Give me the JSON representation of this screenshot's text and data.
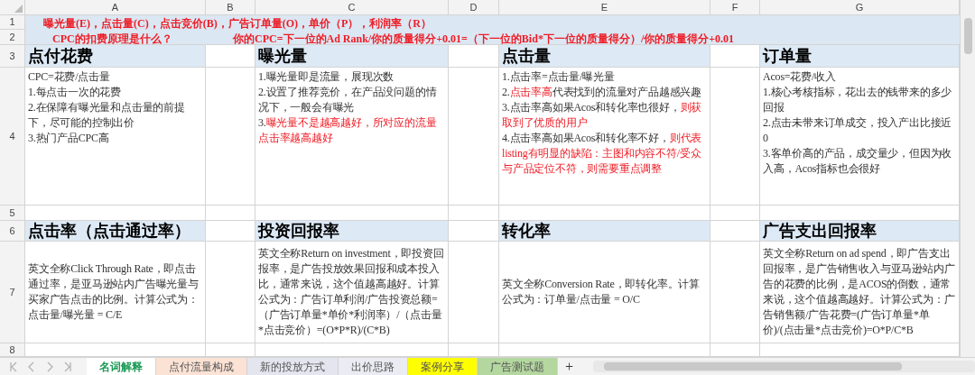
{
  "columns": [
    "A",
    "B",
    "C",
    "D",
    "E",
    "F",
    "G"
  ],
  "row_numbers": [
    "1",
    "2",
    "3",
    "4",
    "5",
    "6",
    "7",
    "8"
  ],
  "banner": {
    "line_1": "曝光量(E)，点击量(C)，点击竞价(B)，广告订单量(O)，单价（P），利润率（R）",
    "question": "CPC的扣费原理是什么？",
    "formula": "你的CPC=下一位的Ad Rank/你的质量得分+0.01=（下一位的Bid*下一位的质量得分）/你的质量得分+0.01"
  },
  "blocks": [
    {
      "sections": [
        {
          "title": "点付花费",
          "paragraphs": [
            [
              {
                "text": "CPC=花费/点击量",
                "emphasized": false
              }
            ],
            [
              {
                "text": "1.每点击一次的花费",
                "emphasized": false
              }
            ],
            [
              {
                "text": "2.在保障有曝光量和点击量的前提下，尽可能的控制出价",
                "emphasized": false
              }
            ],
            [
              {
                "text": "3.热门产品CPC高",
                "emphasized": false
              }
            ]
          ]
        },
        {
          "title": "曝光量",
          "paragraphs": [
            [
              {
                "text": "1.曝光量即是流量，展现次数",
                "emphasized": false
              }
            ],
            [
              {
                "text": "2.设置了推荐竞价，在产品没问题的情况下，一般会有曝光",
                "emphasized": false
              }
            ],
            [
              {
                "text": "3.",
                "emphasized": false
              },
              {
                "text": "曝光量不是越高越好，所对应的流量点击率越高越好",
                "emphasized": true
              }
            ]
          ]
        },
        {
          "title": "点击量",
          "paragraphs": [
            [
              {
                "text": "1.点击率=点击量/曝光量",
                "emphasized": false
              }
            ],
            [
              {
                "text": "2.",
                "emphasized": false
              },
              {
                "text": "点击率高",
                "emphasized": true
              },
              {
                "text": "代表找到的流量对产品越感兴趣",
                "emphasized": false
              }
            ],
            [
              {
                "text": "3.点击率高如果Acos和转化率也很好，",
                "emphasized": false
              },
              {
                "text": "则获取到了优质的用户",
                "emphasized": true
              }
            ],
            [
              {
                "text": "4.点击率高如果Acos和转化率不好，",
                "emphasized": false
              },
              {
                "text": "则代表listing有明显的缺陷：主图和内容不符/受众与产品定位不符，则需要重点调整",
                "emphasized": true
              }
            ]
          ]
        },
        {
          "title": "订单量",
          "paragraphs": [
            [
              {
                "text": "Acos=花费/收入",
                "emphasized": false
              }
            ],
            [
              {
                "text": "1.核心考核指标，花出去的钱带来的多少回报",
                "emphasized": false
              }
            ],
            [
              {
                "text": "2.点击未带来订单成交，投入产出比接近0",
                "emphasized": false
              }
            ],
            [
              {
                "text": "3.客单价高的产品，成交量少，但因为收入高，Acos指标也会很好",
                "emphasized": false
              }
            ]
          ]
        }
      ]
    },
    {
      "sections": [
        {
          "title": "点击率（点击通过率）",
          "paragraphs": [
            [
              {
                "text": "英文全称Click Through Rate，即点击通过率，是亚马逊站内广告曝光量与买家广告点击的比例。计算公式为：点击量/曝光量 = C/E",
                "emphasized": false
              }
            ]
          ]
        },
        {
          "title": "投资回报率",
          "paragraphs": [
            [
              {
                "text": "英文全称Return on investment，即投资回报率，是广告投放效果回报和成本投入比，通常来说，这个值越高越好。计算公式为：广告订单利润/广告投资总额=（广告订单量*单价*利润率）/（点击量*点击竞价）=(O*P*R)/(C*B)",
                "emphasized": false
              }
            ]
          ]
        },
        {
          "title": "转化率",
          "paragraphs": [
            [
              {
                "text": "英文全称Conversion Rate，即转化率。计算公式为：订单量/点击量 = O/C",
                "emphasized": false
              }
            ]
          ]
        },
        {
          "title": "广告支出回报率",
          "paragraphs": [
            [
              {
                "text": "英文全称Return on ad spend，即广告支出回报率，是广告销售收入与亚马逊站内广告的花费的比例，是ACOS的倒数，通常来说，这个值越高越好。计算公式为：广告销售额/广告花费=(广告订单量*单价)/(点击量*点击竞价)=O*P/C*B",
                "emphasized": false
              }
            ]
          ]
        }
      ]
    }
  ],
  "sheet_tabs": [
    {
      "label": "名词解释",
      "selected": true,
      "color": "#ffffff"
    },
    {
      "label": "点付流量构成",
      "selected": false,
      "color": "#fbe2d5"
    },
    {
      "label": "新的投放方式",
      "selected": false,
      "color": "#e4e5ee"
    },
    {
      "label": "出价思路",
      "selected": false,
      "color": "#ebebf3"
    },
    {
      "label": "案例分享",
      "selected": false,
      "color": "#ffff00"
    },
    {
      "label": "广告测试题",
      "selected": false,
      "color": "#b4d7a0"
    }
  ],
  "add_sheet": "+"
}
